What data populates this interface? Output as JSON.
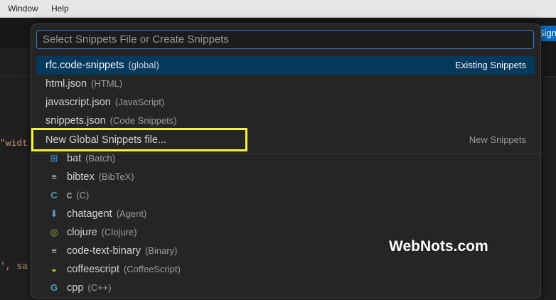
{
  "menubar": {
    "window": "Window",
    "help": "Help"
  },
  "header": {
    "sign_button": "Sign"
  },
  "editor": {
    "line1": "\"widt",
    "line2": "', sa"
  },
  "palette": {
    "search_placeholder": "Select Snippets File or Create Snippets",
    "existing": [
      {
        "name": "rfc.code-snippets",
        "desc": "(global)",
        "right": "Existing Snippets",
        "selected": true
      },
      {
        "name": "html.json",
        "desc": "(HTML)"
      },
      {
        "name": "javascript.json",
        "desc": "(JavaScript)"
      },
      {
        "name": "snippets.json",
        "desc": "(Code Snippets)"
      }
    ],
    "new_global": {
      "name": "New Global Snippets file...",
      "right": "New Snippets"
    },
    "languages": [
      {
        "name": "bat",
        "desc": "(Batch)",
        "icon": "windows-icon"
      },
      {
        "name": "bibtex",
        "desc": "(BibTeX)",
        "icon": "lines-icon"
      },
      {
        "name": "c",
        "desc": "(C)",
        "icon": "c-icon"
      },
      {
        "name": "chatagent",
        "desc": "(Agent)",
        "icon": "arrow-down-icon"
      },
      {
        "name": "clojure",
        "desc": "(Clojure)",
        "icon": "clojure-icon"
      },
      {
        "name": "code-text-binary",
        "desc": "(Binary)",
        "icon": "lines-icon"
      },
      {
        "name": "coffeescript",
        "desc": "(CoffeeScript)",
        "icon": "coffee-icon"
      },
      {
        "name": "cpp",
        "desc": "(C++)",
        "icon": "cpp-icon"
      }
    ]
  },
  "watermark": "WebNots.com",
  "colors": {
    "accent": "#3a7bd5",
    "selected_bg": "#04395e",
    "highlight_border": "#f5f53d",
    "string": "#ce9178"
  }
}
